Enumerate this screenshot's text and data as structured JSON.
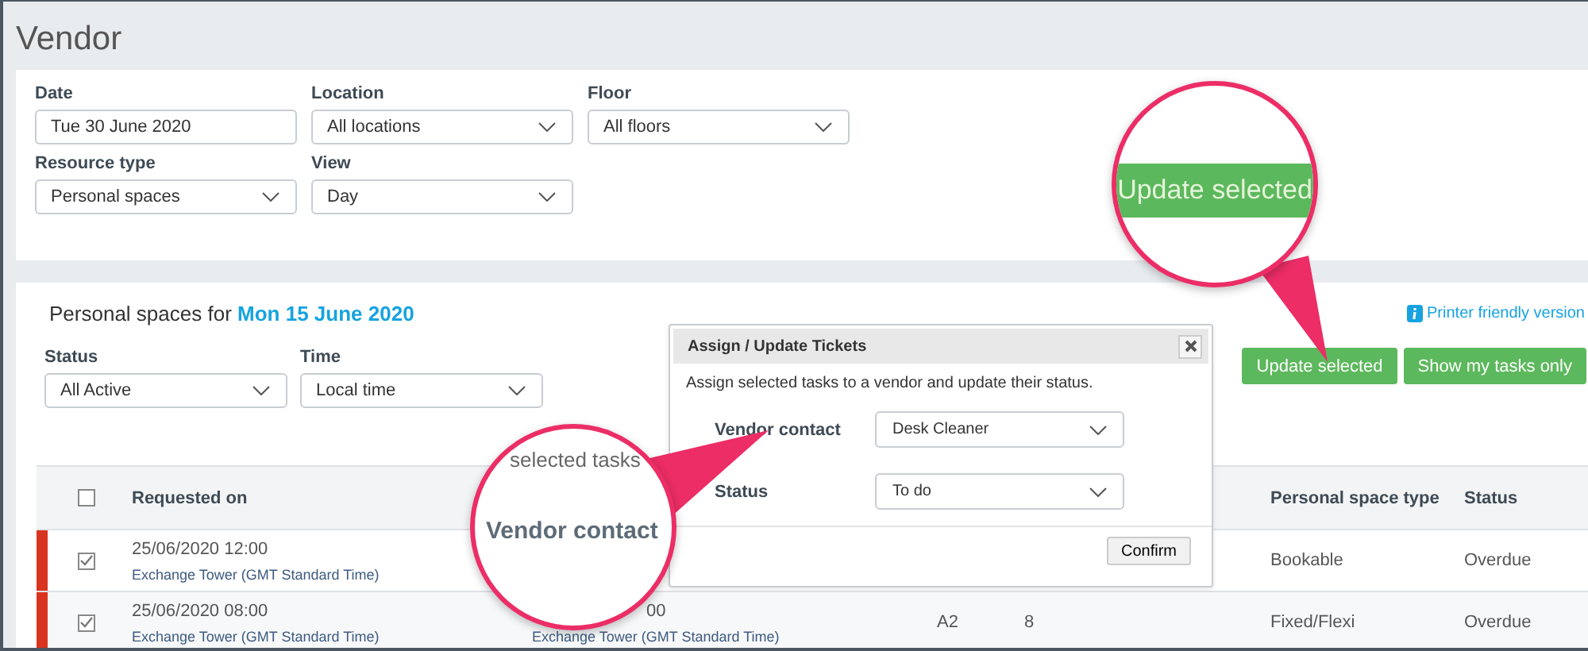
{
  "page": {
    "title": "Vendor"
  },
  "filters": [
    {
      "label": "Date",
      "value": "Tue 30 June 2020",
      "kind": "date"
    },
    {
      "label": "Location",
      "value": "All locations",
      "kind": "select"
    },
    {
      "label": "Floor",
      "value": "All floors",
      "kind": "select"
    },
    {
      "label": "Resource type",
      "value": "Personal spaces",
      "kind": "select"
    },
    {
      "label": "View",
      "value": "Day",
      "kind": "select"
    }
  ],
  "list": {
    "heading": "Personal spaces for",
    "date": "Mon 15 June 2020",
    "printer_link": "Printer friendly version",
    "filters": [
      {
        "label": "Status",
        "value": "All Active"
      },
      {
        "label": "Time",
        "value": "Local time"
      }
    ],
    "buttons": [
      "Update selected",
      "Show my tasks only"
    ]
  },
  "table": {
    "select_all": false,
    "columns": [
      {
        "label": "Requested on"
      },
      {
        "label": "Personal space type"
      },
      {
        "label": "Status"
      }
    ],
    "rows": [
      {
        "checked": true,
        "color": "#d9341f",
        "requested_on": "25/06/2020 12:00",
        "location": "Exchange Tower (GMT Standard Time)",
        "type": "Bookable",
        "status": "Overdue"
      },
      {
        "checked": true,
        "color": "#d9341f",
        "requested_on": "25/06/2020 08:00",
        "location": "Exchange Tower (GMT Standard Time)",
        "column_3": "00",
        "column_3_location": "Exchange Tower (GMT Standard Time)",
        "space": "A2",
        "desk": "8",
        "type": "Fixed/Flexi",
        "status": "Overdue"
      }
    ]
  },
  "dialog": {
    "title": "Assign / Update Tickets",
    "description": "Assign selected tasks to a vendor and update their status.",
    "fields": [
      {
        "label": "Vendor contact",
        "value": "Desk Cleaner"
      },
      {
        "label": "Status",
        "value": "To do"
      }
    ],
    "confirm": "Confirm"
  },
  "callouts": [
    {
      "kind": "button",
      "text": "Update selected"
    },
    {
      "kind": "label",
      "caption": "selected tasks",
      "text": "Vendor contact"
    }
  ]
}
